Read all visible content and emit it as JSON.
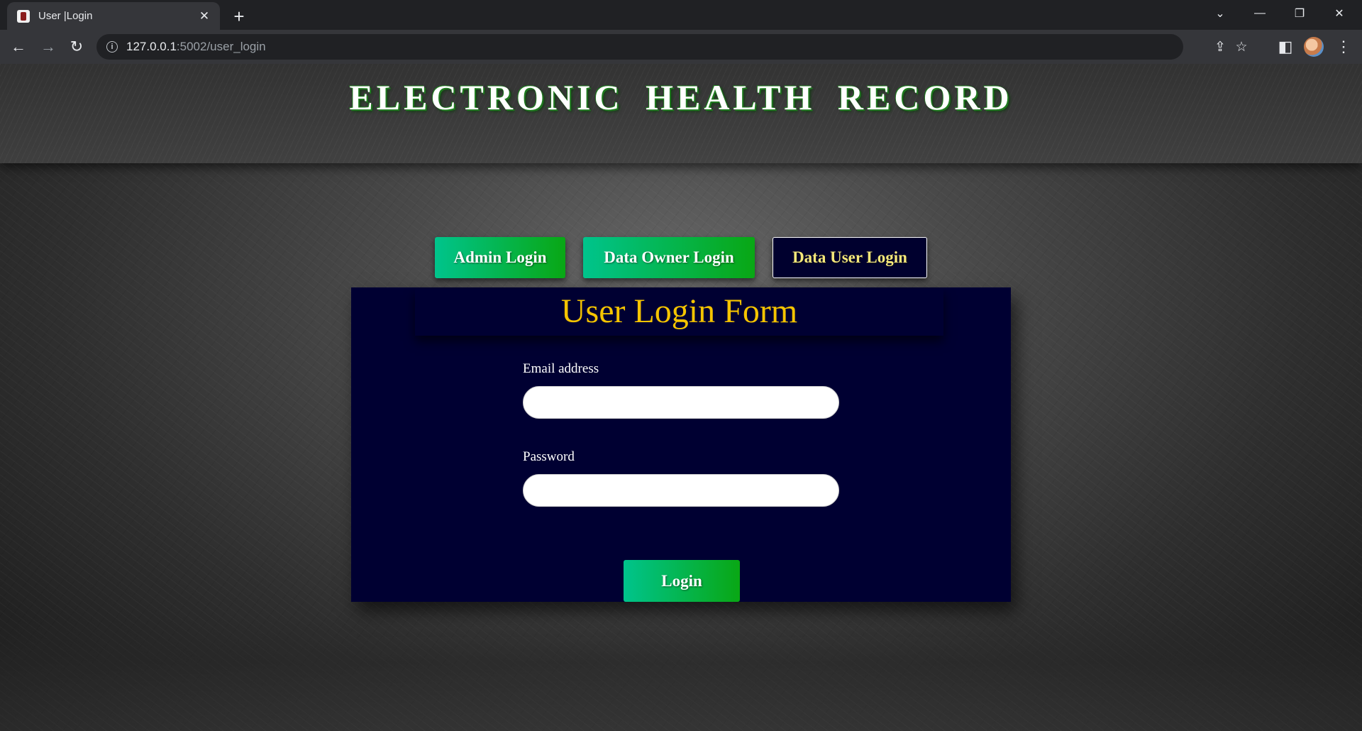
{
  "browser": {
    "tab_title": "User |Login",
    "tab_close": "✕",
    "new_tab": "+",
    "url_host": "127.0.0.1",
    "url_path": ":5002/user_login",
    "window_controls": {
      "dropdown": "⌄",
      "minimize": "—",
      "restore": "❐",
      "close": "✕"
    },
    "nav": {
      "back": "←",
      "forward": "→",
      "reload": "↻"
    },
    "toolbar_icons": {
      "share": "⇪",
      "bookmark": "☆",
      "sidepanel": "◧",
      "menu": "⋮"
    }
  },
  "header": {
    "title": "ELECTRONIC HEALTH RECORD"
  },
  "role_tabs": [
    {
      "label": "Admin Login",
      "active": false
    },
    {
      "label": "Data Owner Login",
      "active": false
    },
    {
      "label": "Data User Login",
      "active": true
    }
  ],
  "form": {
    "heading": "User Login Form",
    "email_label": "Email address",
    "email_value": "",
    "password_label": "Password",
    "password_value": "",
    "submit_label": "Login"
  },
  "colors": {
    "accent_green_start": "#00c48c",
    "accent_green_end": "#09a714",
    "panel_navy": "#000032",
    "heading_gold": "#f5c400",
    "active_tab_text": "#f5e87a"
  }
}
